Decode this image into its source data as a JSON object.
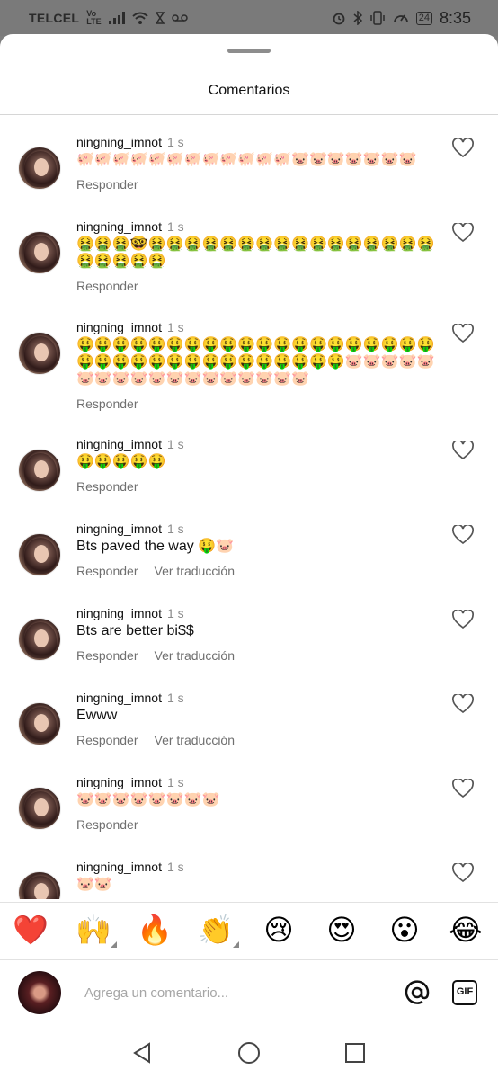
{
  "status_bar": {
    "carrier": "TELCEL",
    "network_top": "Vo",
    "network_bottom": "LTE",
    "battery": "24",
    "time": "8:35"
  },
  "sheet": {
    "title": "Comentarios"
  },
  "comments": [
    {
      "username": "ningning_imnot",
      "time": "1 s",
      "text": "🐖🐖🐖🐖🐖🐖🐖🐖🐖🐖🐖🐖🐷🐷🐷🐷🐷🐷🐷",
      "actions": [
        "Responder"
      ]
    },
    {
      "username": "ningning_imnot",
      "time": "1 s",
      "text": "🤮🤮🤮🤓🤮🤮🤮🤮🤮🤮🤮🤮🤮🤮🤮🤮🤮🤮🤮🤮🤮🤮🤮🤮🤮",
      "actions": [
        "Responder"
      ]
    },
    {
      "username": "ningning_imnot",
      "time": "1 s",
      "text": "🤑🤑🤑🤑🤑🤑🤑🤑🤑🤑🤑🤑🤑🤑🤑🤑🤑🤑🤑🤑🤑🤑🤑🤑🤑🤑🤑🤑🤑🤑🤑🤑🤑🤑🤑🐷🐷🐷🐷🐷🐷🐷🐷🐷🐷🐷🐷🐷🐷🐷🐷🐷🐷",
      "actions": [
        "Responder"
      ]
    },
    {
      "username": "ningning_imnot",
      "time": "1 s",
      "text": "🤑🤑🤑🤑🤑",
      "actions": [
        "Responder"
      ]
    },
    {
      "username": "ningning_imnot",
      "time": "1 s",
      "text": "Bts paved the way 🤑🐷",
      "actions": [
        "Responder",
        "Ver traducción"
      ]
    },
    {
      "username": "ningning_imnot",
      "time": "1 s",
      "text": "Bts are better bi$$",
      "actions": [
        "Responder",
        "Ver traducción"
      ]
    },
    {
      "username": "ningning_imnot",
      "time": "1 s",
      "text": "Ewww",
      "actions": [
        "Responder",
        "Ver traducción"
      ]
    },
    {
      "username": "ningning_imnot",
      "time": "1 s",
      "text": "🐷🐷🐷🐷🐷🐷🐷🐷",
      "actions": [
        "Responder"
      ]
    },
    {
      "username": "ningning_imnot",
      "time": "1 s",
      "text": "🐷🐷",
      "actions": []
    }
  ],
  "emoji_bar": [
    "❤️",
    "🙌",
    "🔥",
    "👏",
    "😢",
    "😍",
    "😮",
    "😂"
  ],
  "composer": {
    "placeholder": "Agrega un comentario...",
    "gif_label": "GIF"
  },
  "icons": {
    "like": "heart-outline-icon",
    "mention": "at-sign-icon",
    "gif": "gif-icon",
    "nav_back": "triangle-back-icon",
    "nav_home": "circle-home-icon",
    "nav_recents": "square-recents-icon"
  }
}
